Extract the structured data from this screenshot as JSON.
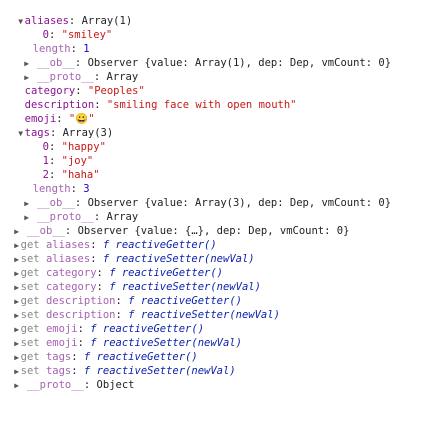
{
  "rows": [
    {
      "tri": "▼",
      "key": "aliases",
      "sep": ": ",
      "val": "Array(1)"
    },
    {
      "key": "0",
      "sep": ": ",
      "val": "\"smiley\""
    },
    {
      "key": "length",
      "sep": ": ",
      "val": "1"
    },
    {
      "tri": "▶",
      "key": "__ob__",
      "sep": ": ",
      "val": "Observer {value: Array(1), dep: Dep, vmCount: 0}"
    },
    {
      "tri": "▶",
      "key": "__proto__",
      "sep": ": ",
      "val": "Array"
    },
    {
      "key": "category",
      "sep": ": ",
      "val": "\"Peoples\""
    },
    {
      "key": "description",
      "sep": ": ",
      "val": "\"smiling face with open mouth\""
    },
    {
      "key": "emoji",
      "sep": ": ",
      "val": "\"😀\""
    },
    {
      "tri": "▼",
      "key": "tags",
      "sep": ": ",
      "val": "Array(3)"
    },
    {
      "key": "0",
      "sep": ": ",
      "val": "\"happy\""
    },
    {
      "key": "1",
      "sep": ": ",
      "val": "\"joy\""
    },
    {
      "key": "2",
      "sep": ": ",
      "val": "\"haha\""
    },
    {
      "key": "length",
      "sep": ": ",
      "val": "3"
    },
    {
      "tri": "▶",
      "key": "__ob__",
      "sep": ": ",
      "val": "Observer {value: Array(3), dep: Dep, vmCount: 0}"
    },
    {
      "tri": "▶",
      "key": "__proto__",
      "sep": ": ",
      "val": "Array"
    },
    {
      "tri": "▶",
      "key": "__ob__",
      "sep": ": ",
      "val": "Observer {value: {…}, dep: Dep, vmCount: 0}"
    },
    {
      "tri": "▶",
      "acc": "get",
      "key": "aliases",
      "sep": ": ",
      "fkw": "f",
      "fname": "reactiveGetter()"
    },
    {
      "tri": "▶",
      "acc": "set",
      "key": "aliases",
      "sep": ": ",
      "fkw": "f",
      "fname": "reactiveSetter(newVal)"
    },
    {
      "tri": "▶",
      "acc": "get",
      "key": "category",
      "sep": ": ",
      "fkw": "f",
      "fname": "reactiveGetter()"
    },
    {
      "tri": "▶",
      "acc": "set",
      "key": "category",
      "sep": ": ",
      "fkw": "f",
      "fname": "reactiveSetter(newVal)"
    },
    {
      "tri": "▶",
      "acc": "get",
      "key": "description",
      "sep": ": ",
      "fkw": "f",
      "fname": "reactiveGetter()"
    },
    {
      "tri": "▶",
      "acc": "set",
      "key": "description",
      "sep": ": ",
      "fkw": "f",
      "fname": "reactiveSetter(newVal)"
    },
    {
      "tri": "▶",
      "acc": "get",
      "key": "emoji",
      "sep": ": ",
      "fkw": "f",
      "fname": "reactiveGetter()"
    },
    {
      "tri": "▶",
      "acc": "set",
      "key": "emoji",
      "sep": ": ",
      "fkw": "f",
      "fname": "reactiveSetter(newVal)"
    },
    {
      "tri": "▶",
      "acc": "get",
      "key": "tags",
      "sep": ": ",
      "fkw": "f",
      "fname": "reactiveGetter()"
    },
    {
      "tri": "▶",
      "acc": "set",
      "key": "tags",
      "sep": ": ",
      "fkw": "f",
      "fname": "reactiveSetter(newVal)"
    },
    {
      "tri": "▶",
      "key": "__proto__",
      "sep": ": ",
      "val": "Object"
    }
  ]
}
